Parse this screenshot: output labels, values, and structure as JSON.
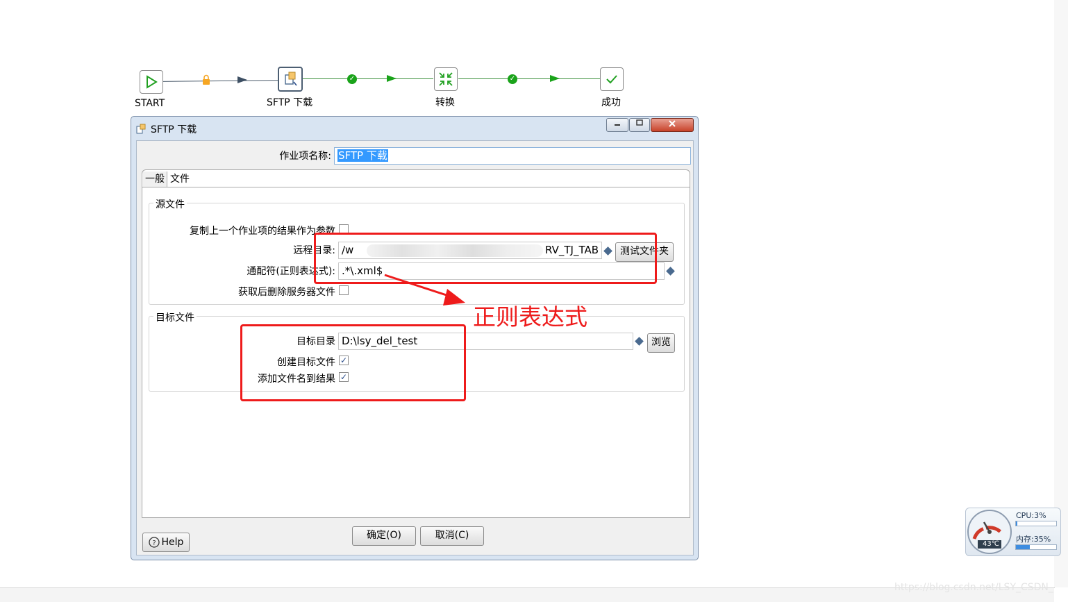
{
  "workflow": {
    "nodes": {
      "start": "START",
      "sftp": "SFTP 下载",
      "transform": "转换",
      "success": "成功"
    }
  },
  "dialog": {
    "title": "SFTP 下载",
    "job_name_label": "作业项名称:",
    "job_name_value": "SFTP 下载",
    "tabs": [
      "一般",
      "文件"
    ],
    "source_group": "源文件",
    "copy_prev_label": "复制上一个作业项的结果作为参数",
    "remote_dir_label": "远程目录:",
    "remote_dir_prefix": "/w",
    "remote_dir_suffix": "RV_TJ_TAB",
    "test_folder_button": "测试文件夹",
    "wildcard_label": "通配符(正则表达式):",
    "wildcard_value": ".*\\.xml$",
    "delete_after_label": "获取后删除服务器文件",
    "target_group": "目标文件",
    "target_dir_label": "目标目录",
    "target_dir_value": "D:\\lsy_del_test",
    "browse_button": "浏览",
    "create_target_label": "创建目标文件",
    "add_filename_label": "添加文件名到结果",
    "ok_button": "确定(O)",
    "cancel_button": "取消(C)",
    "help_button": "Help"
  },
  "annotation": {
    "text": "正则表达式",
    "color": "#ee1b1b"
  },
  "gadget": {
    "cpu_label": "CPU:3%",
    "cpu_percent": 3,
    "mem_label": "内存:35%",
    "mem_percent": 35,
    "temp": "43℃"
  },
  "watermark": "https://blog.csdn.net/LSY_CSDN_"
}
